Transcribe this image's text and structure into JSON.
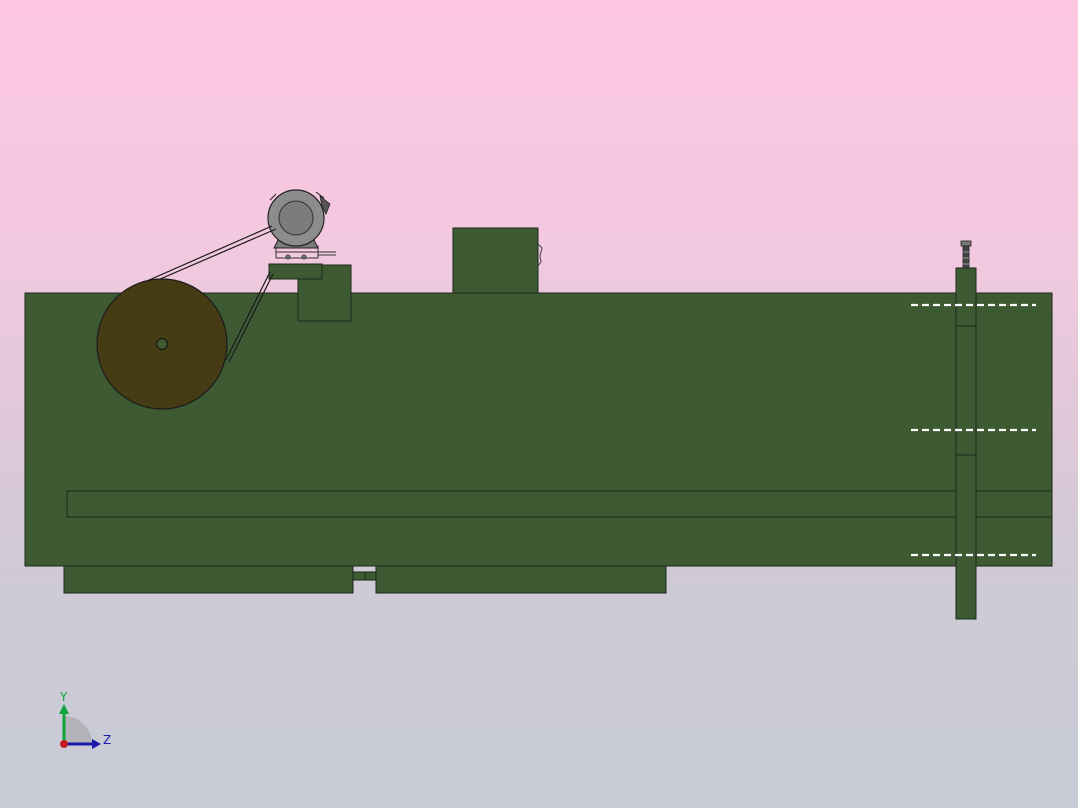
{
  "colors": {
    "body": "#3d5a33",
    "edge": "#1c2a18",
    "pulley": "#453b14",
    "motor": "#8c8c8c",
    "motor_dark": "#555555",
    "hole": "#ffffff",
    "axis_y": "#0fa33b",
    "axis_z": "#1a1aa8",
    "axis_origin": "#c41c1c"
  },
  "icons": {
    "motor": "electric-motor-icon",
    "pulley": "belt-pulley-icon",
    "triad": "coordinate-triad-icon"
  },
  "triad": {
    "y_label": "Y",
    "z_label": "Z"
  }
}
